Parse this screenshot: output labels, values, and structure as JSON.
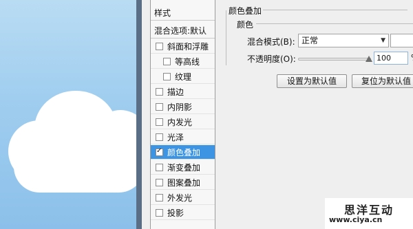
{
  "styles_panel": {
    "header": "样式",
    "blend_options": "混合选项:默认",
    "items": [
      {
        "label": "斜面和浮雕",
        "checked": false,
        "sub": false,
        "selected": false
      },
      {
        "label": "等高线",
        "checked": false,
        "sub": true,
        "selected": false
      },
      {
        "label": "纹理",
        "checked": false,
        "sub": true,
        "selected": false
      },
      {
        "label": "描边",
        "checked": false,
        "sub": false,
        "selected": false
      },
      {
        "label": "内阴影",
        "checked": false,
        "sub": false,
        "selected": false
      },
      {
        "label": "内发光",
        "checked": false,
        "sub": false,
        "selected": false
      },
      {
        "label": "光泽",
        "checked": false,
        "sub": false,
        "selected": false
      },
      {
        "label": "颜色叠加",
        "checked": true,
        "sub": false,
        "selected": true
      },
      {
        "label": "渐变叠加",
        "checked": false,
        "sub": false,
        "selected": false
      },
      {
        "label": "图案叠加",
        "checked": false,
        "sub": false,
        "selected": false
      },
      {
        "label": "外发光",
        "checked": false,
        "sub": false,
        "selected": false
      },
      {
        "label": "投影",
        "checked": false,
        "sub": false,
        "selected": false
      }
    ]
  },
  "color_overlay": {
    "group_title": "颜色叠加",
    "subgroup_title": "颜色",
    "blend_mode_label": "混合模式(B):",
    "blend_mode_value": "正常",
    "opacity_label": "不透明度(O):",
    "opacity_value": "100",
    "opacity_unit": "%",
    "set_default_button": "设置为默认值",
    "reset_default_button": "复位为默认值",
    "swatch_color": "#ffffff"
  },
  "watermark": {
    "title": "思洋互动",
    "url": "www.ciya.cn"
  },
  "colors": {
    "selected_row": "#3c94e2",
    "sky": "#9fcdef",
    "cloud": "#ffffff"
  }
}
